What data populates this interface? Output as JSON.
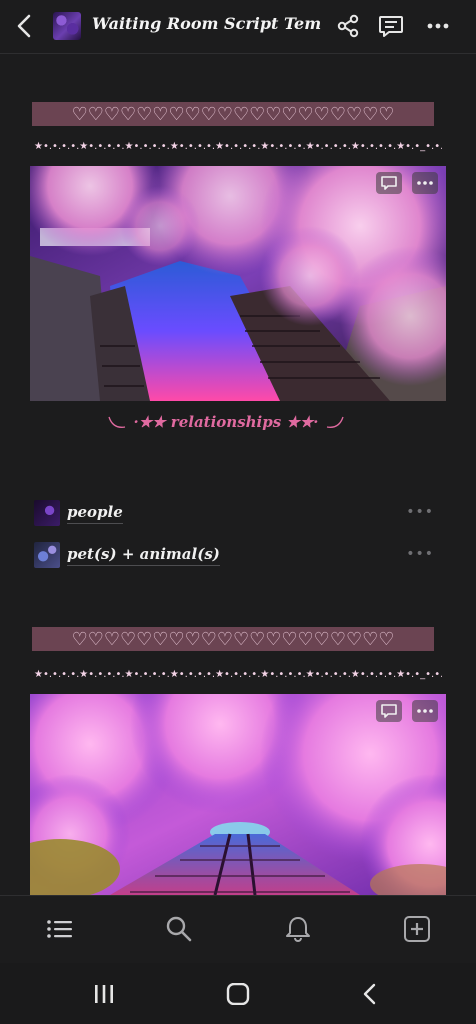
{
  "header": {
    "title": "Waiting Room Script Tem...",
    "icons": [
      "back-icon",
      "share-icon",
      "comment-icon",
      "more-icon"
    ]
  },
  "blocks": {
    "hearts_line": "♡♡♡♡♡♡♡♡♡♡♡♡♡♡♡♡♡♡♡♡",
    "stars_line": "★•.•.•.•.★•.•.•.•.★•.•.•.•.★•.•.•.•.★•.•.•.•.★•.•.•.•.★•.•.•.•.★•.•.•.•.★•.•_•.•.★"
  },
  "caption": "·★★ relationships ★★·",
  "relationships": [
    {
      "label": "people"
    },
    {
      "label": "pet(s) + animal(s)"
    }
  ],
  "colors": {
    "background": "#1c1c1d",
    "heart_band": "#6b4452",
    "caption_pink": "#e06aa0"
  },
  "bottom_nav": [
    "list-icon",
    "search-icon",
    "bell-icon",
    "add-icon"
  ],
  "system_nav": [
    "recents-icon",
    "home-icon",
    "back-icon"
  ]
}
